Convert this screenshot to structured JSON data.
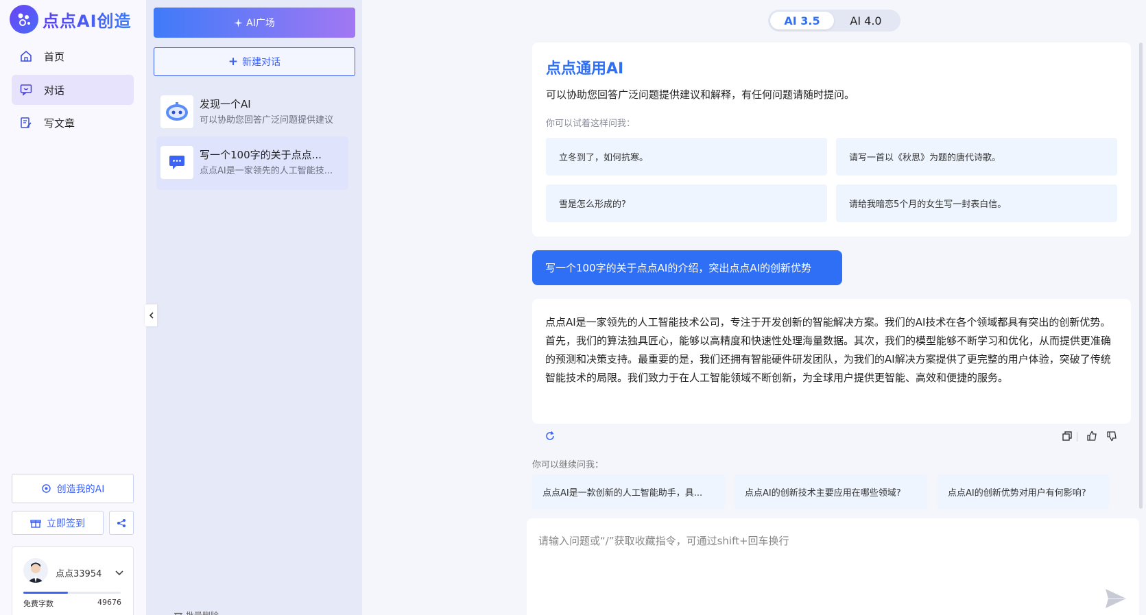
{
  "brand": {
    "name": "点点AI创造"
  },
  "nav": {
    "items": [
      {
        "label": "首页",
        "icon": "home-icon"
      },
      {
        "label": "对话",
        "icon": "chat-icon",
        "active": true
      },
      {
        "label": "写文章",
        "icon": "edit-document-icon"
      }
    ],
    "create_ai_label": "创造我的AI",
    "checkin_label": "立即签到"
  },
  "user": {
    "name": "点点33954",
    "quota_label": "免费字数",
    "quota_value": "49676"
  },
  "list": {
    "ai_square_label": "AI广场",
    "new_chat_label": "新建对话",
    "conversations": [
      {
        "title": "发现一个AI",
        "desc": "可以协助您回答广泛问题提供建议",
        "icon": "robot-icon"
      },
      {
        "title": "写一个100字的关于点点...",
        "desc": "点点AI是一家领先的人工智能技...",
        "icon": "message-bubble-icon",
        "active": true
      }
    ],
    "bulk_delete_label": "批量删除"
  },
  "versions": [
    {
      "label": "AI 3.5",
      "active": true
    },
    {
      "label": "AI 4.0"
    }
  ],
  "intro": {
    "title": "点点通用AI",
    "desc": "可以协助您回答广泛问题提供建议和解释，有任何问题请随时提问。",
    "hint": "你可以试着这样问我：",
    "suggestions": [
      "立冬到了，如何抗寒。",
      "请写一首以《秋思》为题的唐代诗歌。",
      "雪是怎么形成的?",
      "请给我暗恋5个月的女生写一封表白信。"
    ]
  },
  "chat": {
    "user_message": "写一个100字的关于点点AI的介绍，突出点点AI的创新优势",
    "ai_message": "点点AI是一家领先的人工智能技术公司，专注于开发创新的智能解决方案。我们的AI技术在各个领域都具有突出的创新优势。首先，我们的算法独具匠心，能够以高精度和快速性处理海量数据。其次，我们的模型能够不断学习和优化，从而提供更准确的预测和决策支持。最重要的是，我们还拥有智能硬件研发团队，为我们的AI解决方案提供了更完整的用户体验，突破了传统智能技术的局限。我们致力于在人工智能领域不断创新，为全球用户提供更智能、高效和便捷的服务。",
    "follow_label": "你可以继续问我：",
    "follow_ups": [
      "点点AI是一款创新的人工智能助手，具...",
      "点点AI的创新技术主要应用在哪些领域?",
      "点点AI的创新优势对用户有何影响?"
    ]
  },
  "composer": {
    "placeholder": "请输入问题或“/”获取收藏指令，可通过shift+回车换行"
  },
  "colors": {
    "accent": "#2f6ff6",
    "brand_purple": "#6a43f5"
  }
}
